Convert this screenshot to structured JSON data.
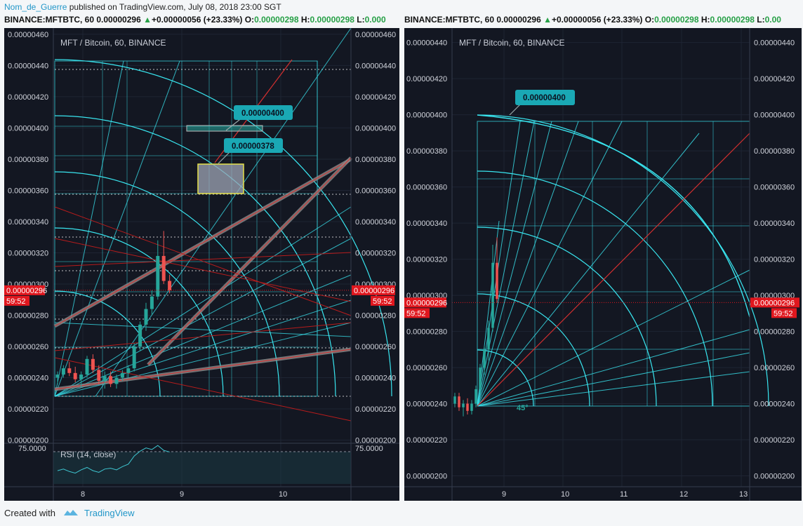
{
  "header": {
    "author": "Nom_de_Guerre",
    "rest": " published on TradingView.com, July 08, 2018 23:00 SGT"
  },
  "ticker_left": {
    "symbol": "BINANCE:MFTBTC, 60",
    "last": "0.00000296",
    "change": "+0.00000056 (+23.33%)",
    "o_label": "O:",
    "o_value": "0.00000298",
    "h_label": "H:",
    "h_value": "0.00000298",
    "l_label": "L:",
    "l_value": "0.000"
  },
  "ticker_right": {
    "symbol": "BINANCE:MFTBTC, 60",
    "last": "0.00000296",
    "change": "+0.00000056 (+23.33%)",
    "o_label": "O:",
    "o_value": "0.00000298",
    "h_label": "H:",
    "h_value": "0.00000298",
    "l_label": "L:",
    "l_value": "0.00"
  },
  "footer": {
    "created_with": "Created with",
    "brand": "TradingView"
  },
  "colors": {
    "background": "#131722",
    "cyan": "#39e6f0",
    "up": "#26a69a",
    "down": "#ef5350",
    "price_tag": "#e0171e"
  },
  "chart_data": [
    {
      "type": "candlestick",
      "title": "MFT / Bitcoin, 60, BINANCE",
      "x_ticks": [
        "8",
        "9",
        "10"
      ],
      "ylim": [
        1.98e-06,
        4.64e-06
      ],
      "y_ticks": [
        "0.00000460",
        "0.00000440",
        "0.00000420",
        "0.00000400",
        "0.00000380",
        "0.00000360",
        "0.00000340",
        "0.00000320",
        "0.00000300",
        "0.00000280",
        "0.00000260",
        "0.00000240",
        "0.00000220",
        "0.00000200"
      ],
      "last_price": "0.00000296",
      "countdown": "59:52",
      "annotations": [
        "0.00000400",
        "0.00000378"
      ],
      "candles_estimated": [
        [
          2.4e-06,
          2.44e-06,
          2.36e-06,
          2.42e-06
        ],
        [
          2.42e-06,
          2.48e-06,
          2.4e-06,
          2.46e-06
        ],
        [
          2.46e-06,
          2.5e-06,
          2.41e-06,
          2.43e-06
        ],
        [
          2.43e-06,
          2.47e-06,
          2.37e-06,
          2.39e-06
        ],
        [
          2.39e-06,
          2.44e-06,
          2.34e-06,
          2.42e-06
        ],
        [
          2.42e-06,
          2.54e-06,
          2.4e-06,
          2.52e-06
        ],
        [
          2.52e-06,
          2.55e-06,
          2.43e-06,
          2.45e-06
        ],
        [
          2.45e-06,
          2.48e-06,
          2.36e-06,
          2.38e-06
        ],
        [
          2.38e-06,
          2.44e-06,
          2.33e-06,
          2.41e-06
        ],
        [
          2.41e-06,
          2.44e-06,
          2.34e-06,
          2.36e-06
        ],
        [
          2.36e-06,
          2.42e-06,
          2.33e-06,
          2.4e-06
        ],
        [
          2.4e-06,
          2.45e-06,
          2.38e-06,
          2.43e-06
        ],
        [
          2.43e-06,
          2.48e-06,
          2.4e-06,
          2.46e-06
        ],
        [
          2.46e-06,
          2.62e-06,
          2.44e-06,
          2.6e-06
        ],
        [
          2.6e-06,
          2.76e-06,
          2.57e-06,
          2.74e-06
        ],
        [
          2.74e-06,
          2.88e-06,
          2.7e-06,
          2.84e-06
        ],
        [
          2.84e-06,
          2.96e-06,
          2.8e-06,
          2.92e-06
        ],
        [
          2.92e-06,
          3.28e-06,
          2.9e-06,
          3.18e-06
        ],
        [
          3.18e-06,
          3.34e-06,
          3e-06,
          3.02e-06
        ],
        [
          3.02e-06,
          3.06e-06,
          2.94e-06,
          2.96e-06
        ]
      ],
      "rsi": {
        "label": "RSI (14, close)",
        "level": "75.0000",
        "values_estimated": [
          48,
          50,
          47,
          45,
          49,
          52,
          48,
          46,
          50,
          51,
          49,
          53,
          56,
          66,
          72,
          76,
          74,
          79,
          73,
          71
        ]
      }
    },
    {
      "type": "candlestick",
      "title": "MFT / Bitcoin, 60, BINANCE",
      "x_ticks": [
        "9",
        "10",
        "11",
        "12",
        "13"
      ],
      "ylim": [
        1.94e-06,
        4.48e-06
      ],
      "y_ticks": [
        "0.00000440",
        "0.00000420",
        "0.00000400",
        "0.00000380",
        "0.00000360",
        "0.00000340",
        "0.00000320",
        "0.00000300",
        "0.00000280",
        "0.00000260",
        "0.00000240",
        "0.00000220",
        "0.00000200"
      ],
      "last_price": "0.00000296",
      "countdown": "59:52",
      "annotations": [
        "0.00000400",
        "45°"
      ],
      "candles_estimated": [
        [
          2.4e-06,
          2.46e-06,
          2.38e-06,
          2.44e-06
        ],
        [
          2.44e-06,
          2.46e-06,
          2.36e-06,
          2.38e-06
        ],
        [
          2.38e-06,
          2.42e-06,
          2.33e-06,
          2.4e-06
        ],
        [
          2.4e-06,
          2.43e-06,
          2.34e-06,
          2.36e-06
        ],
        [
          2.36e-06,
          2.42e-06,
          2.34e-06,
          2.4e-06
        ],
        [
          2.4e-06,
          2.5e-06,
          2.38e-06,
          2.48e-06
        ],
        [
          2.48e-06,
          2.62e-06,
          2.46e-06,
          2.6e-06
        ],
        [
          2.6e-06,
          2.72e-06,
          2.56e-06,
          2.7e-06
        ],
        [
          2.7e-06,
          2.86e-06,
          2.64e-06,
          2.82e-06
        ],
        [
          2.82e-06,
          3.28e-06,
          2.8e-06,
          3.18e-06
        ],
        [
          3.18e-06,
          3.32e-06,
          2.96e-06,
          2.98e-06
        ]
      ]
    }
  ]
}
